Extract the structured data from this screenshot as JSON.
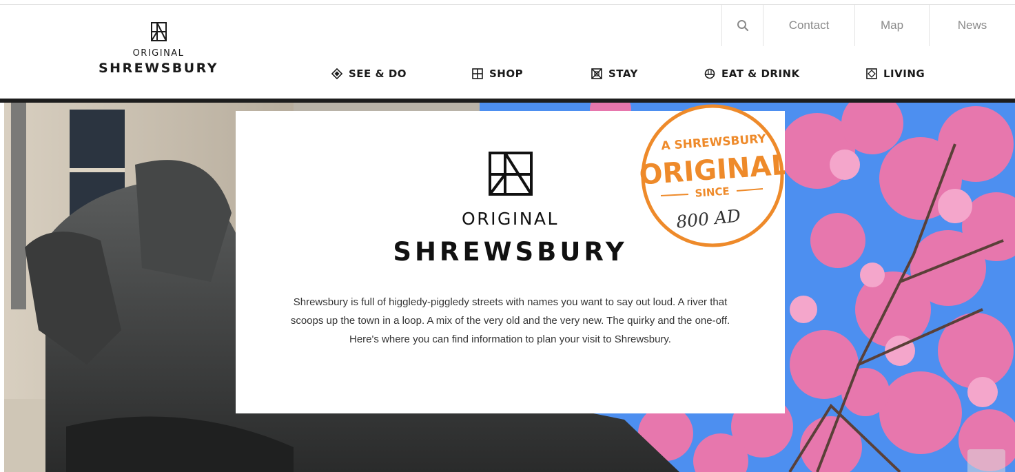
{
  "header": {
    "logo": {
      "line1": "ORIGINAL",
      "line2": "SHREWSBURY"
    },
    "utility_nav": [
      {
        "icon": "search-icon",
        "label": ""
      },
      {
        "label": "Contact"
      },
      {
        "label": "Map"
      },
      {
        "label": "News"
      }
    ],
    "main_nav": [
      {
        "icon": "diamond-icon",
        "label": "SEE & DO"
      },
      {
        "icon": "grid-icon",
        "label": "SHOP"
      },
      {
        "icon": "bed-icon",
        "label": "STAY"
      },
      {
        "icon": "dish-icon",
        "label": "EAT & DRINK"
      },
      {
        "icon": "home-icon",
        "label": "LIVING"
      }
    ]
  },
  "hero": {
    "card": {
      "logo_line1": "ORIGINAL",
      "logo_line2": "SHREWSBURY",
      "description": "Shrewsbury is full of higgledy-piggledy streets with names you want to say out loud. A river that scoops up the town in a loop. A mix of the very old and the very new. The quirky and the one-off. Here's where you can find information to plan your visit to Shrewsbury."
    },
    "badge": {
      "line1": "A SHREWSBURY",
      "line2": "ORIGINAL",
      "line3": "SINCE",
      "line4": "800 AD"
    }
  },
  "colors": {
    "badge_orange": "#ee8a2a",
    "text_dark": "#1a1a1a",
    "utility_text": "#8a8a8a",
    "sky": "#4d8ff0",
    "blossom": "#e777ad"
  }
}
